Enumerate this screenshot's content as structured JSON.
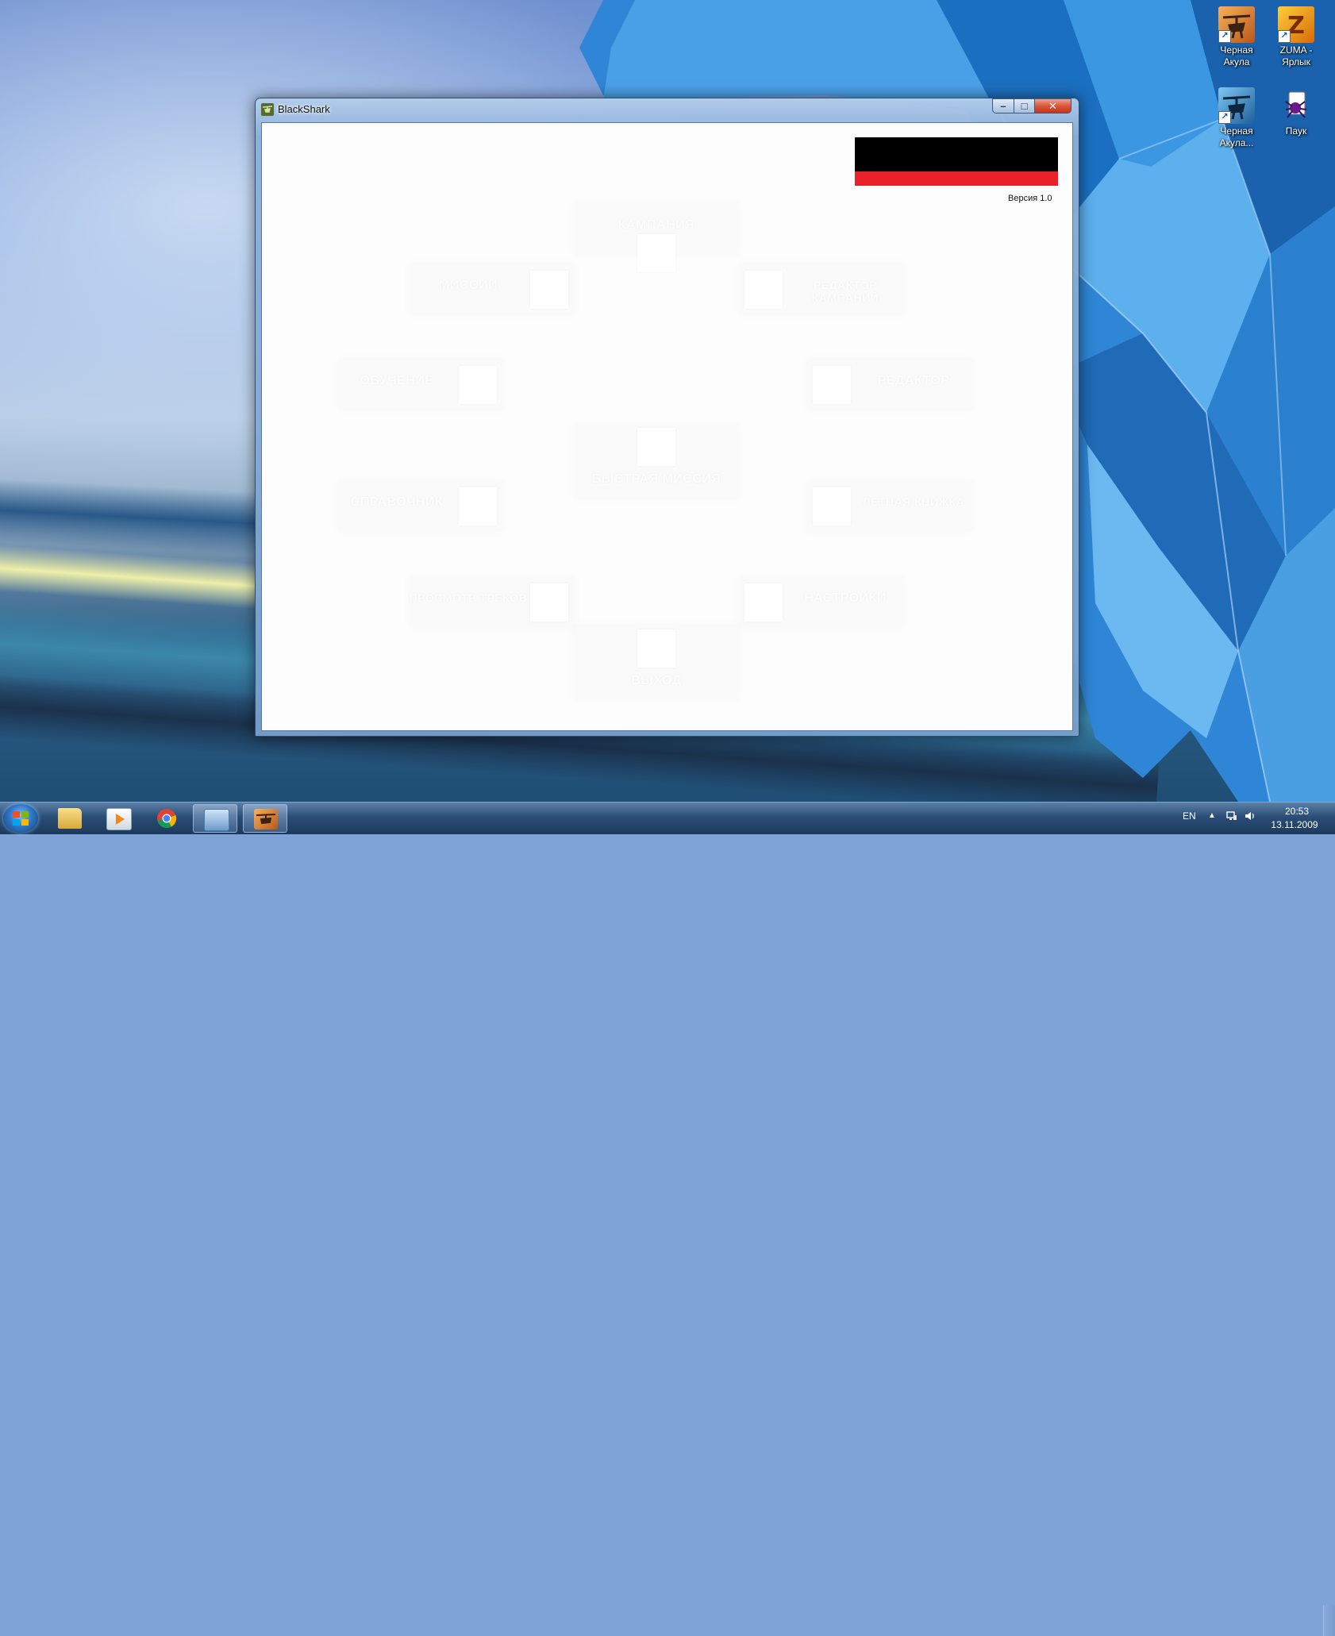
{
  "window": {
    "title": "BlackShark",
    "minimize_glyph": "–",
    "maximize_glyph": "□",
    "close_glyph": "✕",
    "version": "Версия 1.0",
    "menu": [
      {
        "id": "campaign",
        "label": "КАМПАНИЯ"
      },
      {
        "id": "missions",
        "label": "МИССИИ"
      },
      {
        "id": "campaign-editor",
        "label": "РЕДАКТОР КАМПАНИЙ"
      },
      {
        "id": "training",
        "label": "ОБУЧЕНИЕ"
      },
      {
        "id": "editor",
        "label": "РЕДАКТОР"
      },
      {
        "id": "quick-mission",
        "label": "БЫСТРАЯ МИССИЯ"
      },
      {
        "id": "encyclopedia",
        "label": "СПРАВОЧНИК"
      },
      {
        "id": "logbook",
        "label": "ЛЕТНАЯ КНИЖКА"
      },
      {
        "id": "replay",
        "label": "ПРОСМОТР ТРЕКОВ"
      },
      {
        "id": "options",
        "label": "НАСТРОЙКИ"
      },
      {
        "id": "exit",
        "label": "ВЫХОД"
      }
    ]
  },
  "desktop_icons": [
    {
      "label": "Черная Акула",
      "icon": "helicopter-orange-icon"
    },
    {
      "label": "ZUMA - Ярлык",
      "icon": "zuma-icon"
    },
    {
      "label": "Черная Акула...",
      "icon": "helicopter-blue-icon"
    },
    {
      "label": "Паук",
      "icon": "spider-solitaire-icon"
    }
  ],
  "taskbar": {
    "items": [
      {
        "name": "explorer",
        "icon": "folder-icon"
      },
      {
        "name": "media-player",
        "icon": "media-player-icon"
      },
      {
        "name": "chrome",
        "icon": "chrome-icon"
      },
      {
        "name": "control-panel",
        "icon": "control-panel-icon"
      },
      {
        "name": "blackshark",
        "icon": "helicopter-orange-icon"
      }
    ],
    "language": "EN",
    "time": "20:53",
    "date": "13.11.2009"
  },
  "colors": {
    "logo_black": "#000000",
    "logo_red": "#e8202a",
    "close_button": "#c4351c"
  }
}
